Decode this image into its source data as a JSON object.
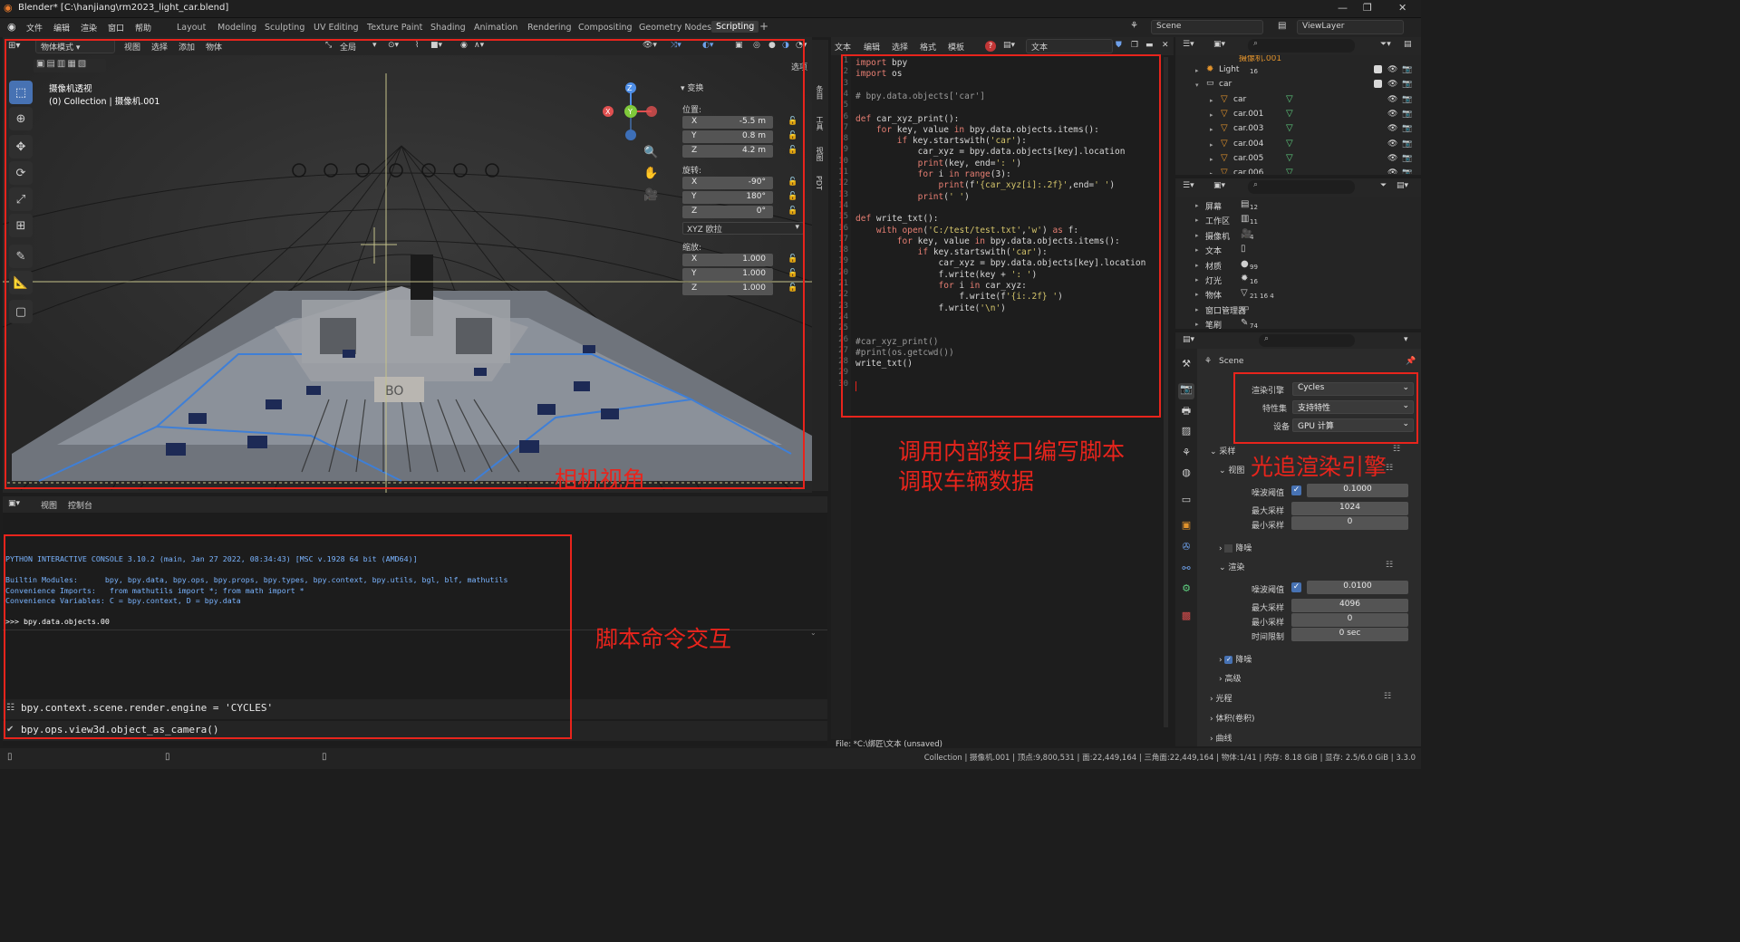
{
  "window": {
    "title": "Blender* [C:\\hanjiang\\rm2023_light_car.blend]",
    "controls": [
      "—",
      "❐",
      "✕"
    ]
  },
  "menu": [
    "文件",
    "编辑",
    "渲染",
    "窗口",
    "帮助"
  ],
  "workspaces": [
    "Layout",
    "Modeling",
    "Sculpting",
    "UV Editing",
    "Texture Paint",
    "Shading",
    "Animation",
    "Rendering",
    "Compositing",
    "Geometry Nodes",
    "Scripting"
  ],
  "active_workspace": "Scripting",
  "scene_name": "Scene",
  "view_layer": "ViewLayer",
  "viewport": {
    "mode": "物体模式",
    "menus": [
      "视图",
      "选择",
      "添加",
      "物体"
    ],
    "transform_orientation": "全局",
    "overlay_line1": "摄像机透视",
    "overlay_line2": "(0) Collection | 摄像机.001",
    "options_label": "选项",
    "side_tabs": [
      "条目",
      "工具",
      "视图",
      "PDT"
    ],
    "field_label": "BO",
    "transform": {
      "header": "变换",
      "location_label": "位置:",
      "location": [
        {
          "axis": "X",
          "value": "-5.5 m"
        },
        {
          "axis": "Y",
          "value": "0.8 m"
        },
        {
          "axis": "Z",
          "value": "4.2 m"
        }
      ],
      "rotation_label": "旋转:",
      "rotation": [
        {
          "axis": "X",
          "value": "-90°"
        },
        {
          "axis": "Y",
          "value": "180°"
        },
        {
          "axis": "Z",
          "value": "0°"
        }
      ],
      "rotation_mode": "XYZ 欧拉",
      "scale_label": "缩放:",
      "scale": [
        {
          "axis": "X",
          "value": "1.000"
        },
        {
          "axis": "Y",
          "value": "1.000"
        },
        {
          "axis": "Z",
          "value": "1.000"
        }
      ]
    },
    "gizmo": {
      "x": "X",
      "y": "Y",
      "z": "Z"
    }
  },
  "text_editor": {
    "menus": [
      "文本",
      "编辑",
      "选择",
      "格式",
      "模板"
    ],
    "text_name": "文本",
    "file_status": "File: *C:\\绑匠\\文本 (unsaved)",
    "lines": [
      "import bpy",
      "import os",
      "",
      "# bpy.data.objects['car']",
      "",
      "def car_xyz_print():",
      "    for key, value in bpy.data.objects.items():",
      "        if key.startswith('car'):",
      "            car_xyz = bpy.data.objects[key].location",
      "            print(key, end=': ')",
      "            for i in range(3):",
      "                print(f'{car_xyz[i]:.2f}',end=' ')",
      "            print(' ')",
      "",
      "def write_txt():",
      "    with open('C:/test/test.txt','w') as f:",
      "        for key, value in bpy.data.objects.items():",
      "            if key.startswith('car'):",
      "                car_xyz = bpy.data.objects[key].location",
      "                f.write(key + ': ')",
      "                for i in car_xyz:",
      "                    f.write(f'{i:.2f} ')",
      "                f.write('\\n')",
      "",
      "",
      "#car_xyz_print()",
      "#print(os.getcwd())",
      "write_txt()",
      "",
      ""
    ]
  },
  "console": {
    "menus": [
      "视图",
      "控制台"
    ],
    "lines": [
      "PYTHON INTERACTIVE CONSOLE 3.10.2 (main, Jan 27 2022, 08:34:43) [MSC v.1928 64 bit (AMD64)]",
      "",
      "Builtin Modules:      bpy, bpy.data, bpy.ops, bpy.props, bpy.types, bpy.context, bpy.utils, bgl, blf, mathutils",
      "Convenience Imports:   from mathutils import *; from math import *",
      "Convenience Variables: C = bpy.context, D = bpy.data",
      "",
      ">>> bpy.data.objects.00"
    ],
    "info1": "bpy.context.scene.render.engine = 'CYCLES'",
    "info2": "bpy.ops.view3d.object_as_camera()"
  },
  "outliner": {
    "partial_top": "摄像机.001",
    "items": [
      {
        "label": "Light",
        "count": "16",
        "indent": 1
      },
      {
        "label": "car",
        "count": "",
        "indent": 1
      },
      {
        "label": "car",
        "count": "",
        "indent": 2
      },
      {
        "label": "car.001",
        "count": "",
        "indent": 2
      },
      {
        "label": "car.003",
        "count": "",
        "indent": 2
      },
      {
        "label": "car.004",
        "count": "",
        "indent": 2
      },
      {
        "label": "car.005",
        "count": "",
        "indent": 2
      },
      {
        "label": "car.006",
        "count": "",
        "indent": 2
      }
    ]
  },
  "blend_data": {
    "items": [
      {
        "label": "屏幕",
        "count": "12"
      },
      {
        "label": "工作区",
        "count": "11"
      },
      {
        "label": "摄像机",
        "count": "4"
      },
      {
        "label": "文本",
        "count": ""
      },
      {
        "label": "材质",
        "count": "99"
      },
      {
        "label": "灯光",
        "count": "16"
      },
      {
        "label": "物体",
        "count": "21 16 4"
      },
      {
        "label": "窗口管理器",
        "count": ""
      },
      {
        "label": "笔刷",
        "count": "74"
      }
    ]
  },
  "properties": {
    "scene": "Scene",
    "engine_label": "渲染引擎",
    "engine": "Cycles",
    "feature_label": "特性集",
    "feature": "支持特性",
    "device_label": "设备",
    "device": "GPU 计算",
    "sampling": "采样",
    "viewport_section": "视图",
    "noise_threshold_label": "噪波阈值",
    "vp_noise": "0.1000",
    "max_samples_label": "最大采样",
    "vp_max": "1024",
    "min_samples_label": "最小采样",
    "vp_min": "0",
    "denoise_label": "降噪",
    "render_section": "渲染",
    "r_noise": "0.0100",
    "r_max": "4096",
    "r_min": "0",
    "time_limit_label": "时间限制",
    "r_time": "0 sec",
    "advanced": "高级",
    "light_paths": "光程",
    "volumes": "体积(卷积)",
    "curves": "曲线"
  },
  "annotations": {
    "camera": "相机视角",
    "script1": "调用内部接口编写脚本",
    "script2": "调取车辆数据",
    "console": "脚本命令交互",
    "engine": "光追渲染引擎"
  },
  "status": "Collection | 摄像机.001 | 顶点:9,800,531 | 面:22,449,164 | 三角面:22,449,164 | 物体:1/41 | 内存: 8.18 GiB | 显存: 2.5/6.0 GiB | 3.3.0",
  "colors": {
    "annotation": "#e8241c",
    "accent": "#4772b3",
    "object_icon": "#e2932c",
    "mesh_icon": "#5fcf7f"
  }
}
